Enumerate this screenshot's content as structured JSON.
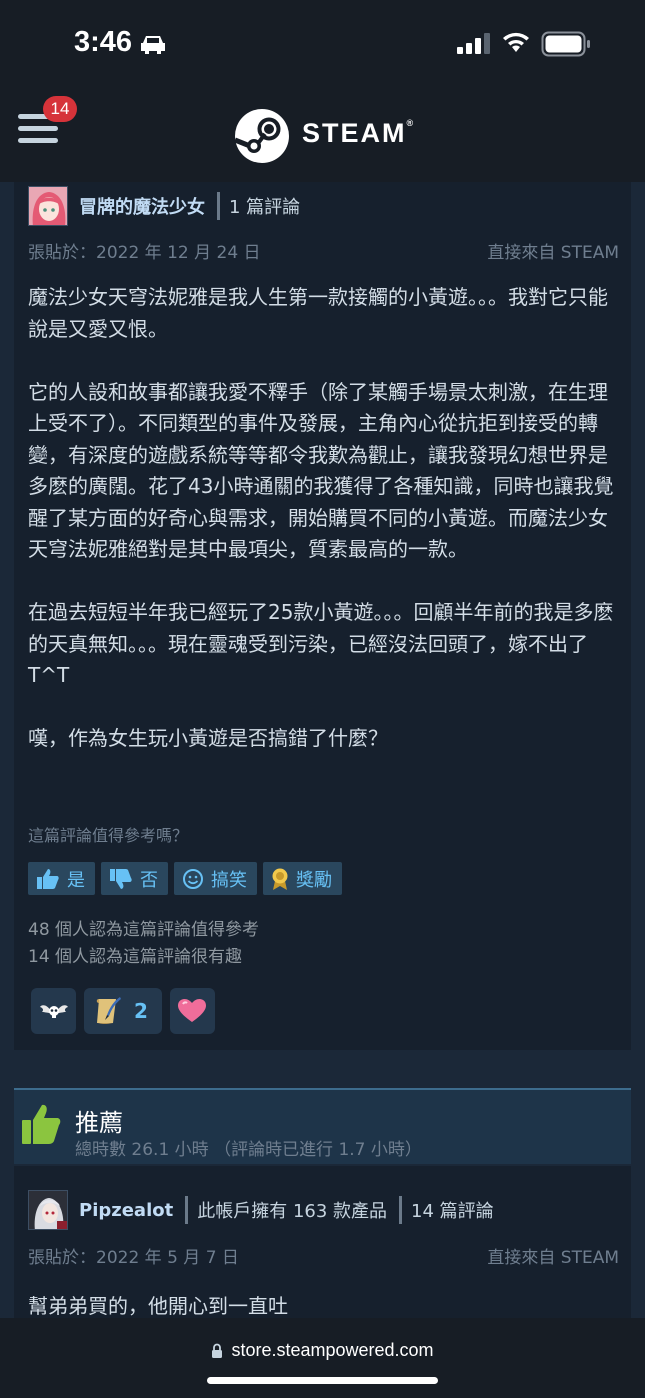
{
  "status_bar": {
    "time": "3:46"
  },
  "header": {
    "notification_count": "14",
    "brand": "STEAM",
    "brand_mark": "®"
  },
  "review1": {
    "author_name": "冒牌的魔法少女",
    "author_meta": "1 篇評論",
    "posted_date": "張貼於：2022 年 12 月 24 日",
    "source": "直接來自 STEAM",
    "paragraphs": [
      "魔法少女天穹法妮雅是我人生第一款接觸的小黃遊。。。我對它只能說是又愛又恨。",
      "它的人設和故事都讓我愛不釋手（除了某觸手場景太刺激，在生理上受不了）。不同類型的事件及發展，主角內心從抗拒到接受的轉變，有深度的遊戲系統等等都令我歎為觀止，讓我發現幻想世界是多麽的廣闊。花了43小時通關的我獲得了各種知識，同時也讓我覺醒了某方面的好奇心與需求，開始購買不同的小黃遊。而魔法少女天穹法妮雅絕對是其中最項尖，質素最高的一款。",
      "在過去短短半年我已經玩了25款小黃遊。。。回顧半年前的我是多麽的天真無知。。。現在靈魂受到污染，已經沒法回頭了，嫁不出了 T^T",
      "嘆，作為女生玩小黃遊是否搞錯了什麼？"
    ],
    "helpful_question": "這篇評論值得參考嗎？",
    "buttons": {
      "yes": "是",
      "no": "否",
      "funny": "搞笑",
      "award": "獎勵"
    },
    "helpful_count": "48 個人認為這篇評論值得參考",
    "funny_count": "14 個人認為這篇評論很有趣",
    "awards": [
      {
        "icon": "winged-skull-icon",
        "count": ""
      },
      {
        "icon": "scroll-quill-icon",
        "count": "2"
      },
      {
        "icon": "heart-icon",
        "count": ""
      }
    ]
  },
  "recommendation": {
    "title": "推薦",
    "playtime": "總時數 26.1 小時 （評論時已進行 1.7 小時）"
  },
  "review2": {
    "author_name": "Pipzealot",
    "products": "此帳戶擁有 163 款產品",
    "reviews": "14 篇評論",
    "posted_date": "張貼於：2022 年 5 月 7 日",
    "source": "直接來自 STEAM",
    "text": "幫弟弟買的，他開心到一直吐"
  },
  "browser": {
    "url": "store.steampowered.com"
  },
  "colors": {
    "bg": "#1b2838",
    "card": "#16202d",
    "accent": "#67c1f5",
    "badge": "#d6333a",
    "recommend": "#1e3449"
  }
}
